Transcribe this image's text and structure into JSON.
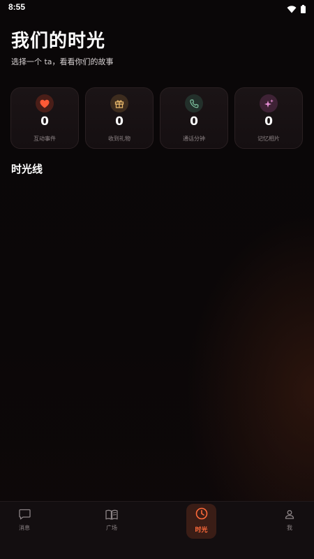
{
  "status_bar": {
    "time": "8:55",
    "wifi_icon": "wifi-icon",
    "battery_icon": "battery-icon"
  },
  "header": {
    "title": "我们的时光",
    "subtitle": "选择一个 ta，看看你们的故事"
  },
  "stats": [
    {
      "icon": "heart-icon",
      "value": "0",
      "label": "互动事件",
      "icon_color": "#ff5a36",
      "icon_bg": "#4a1e18"
    },
    {
      "icon": "gift-icon",
      "value": "0",
      "label": "收到礼物",
      "icon_color": "#e6b66a",
      "icon_bg": "#3d2c1e"
    },
    {
      "icon": "phone-icon",
      "value": "0",
      "label": "通话分钟",
      "icon_color": "#7fc4a0",
      "icon_bg": "#23302b"
    },
    {
      "icon": "sparkles-icon",
      "value": "0",
      "label": "记忆相片",
      "icon_color": "#e28bd1",
      "icon_bg": "#3e2235"
    }
  ],
  "timeline": {
    "title": "时光线"
  },
  "bottom_nav": {
    "items": [
      {
        "icon": "chat-icon",
        "label": "消息",
        "active": false
      },
      {
        "icon": "book-icon",
        "label": "广场",
        "active": false
      },
      {
        "icon": "clock-icon",
        "label": "时光",
        "active": true
      },
      {
        "icon": "user-icon",
        "label": "我",
        "active": false
      }
    ],
    "active_color": "#ff6a3a",
    "inactive_color": "#8d8587"
  }
}
